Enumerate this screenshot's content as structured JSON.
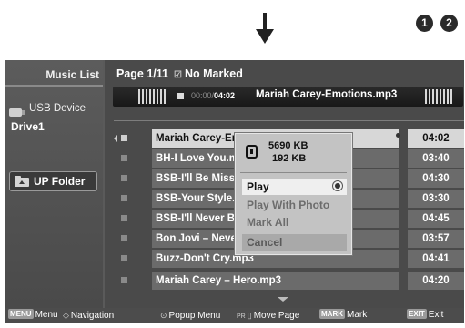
{
  "steps": [
    "1",
    "2"
  ],
  "sidebar": {
    "title": "Music List",
    "device": "USB Device",
    "drive": "Drive1",
    "up_folder": "UP Folder"
  },
  "header": {
    "page": "Page 1/11",
    "marked": "No Marked"
  },
  "now_playing": {
    "time_elapsed": "00:00/",
    "time_total": "04:02",
    "file": "Mariah Carey-Emotions.mp3"
  },
  "tracks": [
    {
      "title": "Mariah Carey-Emotions.mp3",
      "duration": "04:02"
    },
    {
      "title": "BH-I Love You.mp3",
      "duration": "03:40"
    },
    {
      "title": "BSB-I'll Be Missing You.mp3",
      "duration": "04:30"
    },
    {
      "title": "BSB-Your Style.mp3",
      "duration": "03:30"
    },
    {
      "title": "BSB-I'll Never Break.mp3",
      "duration": "04:45"
    },
    {
      "title": "Bon Jovi – Never Say.mp3",
      "duration": "03:57"
    },
    {
      "title": "Buzz-Don't Cry.mp3",
      "duration": "04:41"
    },
    {
      "title": "Mariah Carey – Hero.mp3",
      "duration": "04:20"
    }
  ],
  "popup": {
    "size_kb": "5690 KB",
    "size_kb2": "192 KB",
    "menu": [
      "Play",
      "Play With Photo",
      "Mark All",
      "Cancel"
    ]
  },
  "helpbar": {
    "menu_key": "MENU",
    "menu_label": "Menu",
    "nav_label": "Navigation",
    "popup_label": "Popup Menu",
    "page_key": "PR",
    "page_label": "Move Page",
    "mark_key": "MARK",
    "mark_label": "Mark",
    "exit_key": "EXIT",
    "exit_label": "Exit"
  },
  "colors": {
    "screen_bg": "#5a5a5a",
    "row_bg": "#6b6b6b",
    "row_selected": "#d7d7d7",
    "popup_bg": "#c3c3c3"
  }
}
